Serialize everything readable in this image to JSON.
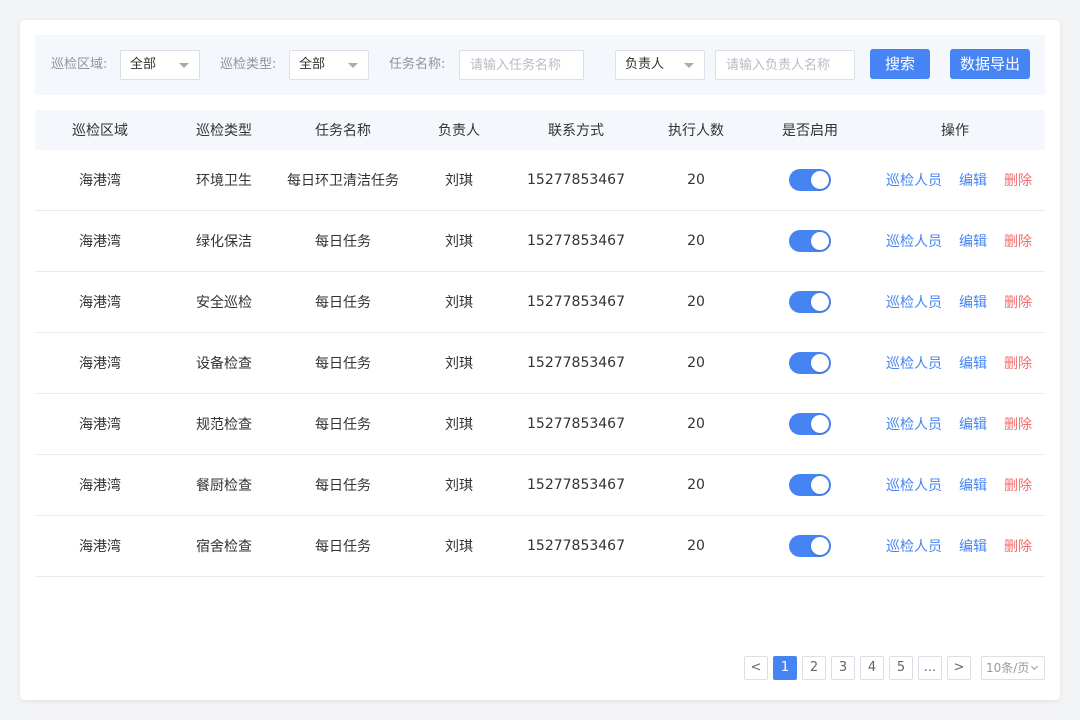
{
  "filters": {
    "area_label": "巡检区域:",
    "area_value": "全部",
    "type_label": "巡检类型:",
    "type_value": "全部",
    "task_label": "任务名称:",
    "task_placeholder": "请输入任务名称",
    "owner_select_value": "负责人",
    "owner_placeholder": "请输入负责人名称",
    "search_label": "搜索",
    "export_label": "数据导出"
  },
  "table": {
    "headers": [
      "巡检区域",
      "巡检类型",
      "任务名称",
      "负责人",
      "联系方式",
      "执行人数",
      "是否启用",
      "操作"
    ],
    "rows": [
      {
        "area": "海港湾",
        "type": "环境卫生",
        "task": "每日环卫清洁任务",
        "owner": "刘琪",
        "phone": "15277853467",
        "count": "20",
        "enabled": true
      },
      {
        "area": "海港湾",
        "type": "绿化保洁",
        "task": "每日任务",
        "owner": "刘琪",
        "phone": "15277853467",
        "count": "20",
        "enabled": true
      },
      {
        "area": "海港湾",
        "type": "安全巡检",
        "task": "每日任务",
        "owner": "刘琪",
        "phone": "15277853467",
        "count": "20",
        "enabled": true
      },
      {
        "area": "海港湾",
        "type": "设备检查",
        "task": "每日任务",
        "owner": "刘琪",
        "phone": "15277853467",
        "count": "20",
        "enabled": true
      },
      {
        "area": "海港湾",
        "type": "规范检查",
        "task": "每日任务",
        "owner": "刘琪",
        "phone": "15277853467",
        "count": "20",
        "enabled": true
      },
      {
        "area": "海港湾",
        "type": "餐厨检查",
        "task": "每日任务",
        "owner": "刘琪",
        "phone": "15277853467",
        "count": "20",
        "enabled": true
      },
      {
        "area": "海港湾",
        "type": "宿舍检查",
        "task": "每日任务",
        "owner": "刘琪",
        "phone": "15277853467",
        "count": "20",
        "enabled": true
      }
    ],
    "actions": {
      "inspectors": "巡检人员",
      "edit": "编辑",
      "delete": "删除"
    }
  },
  "pagination": {
    "prev": "<",
    "pages": [
      "1",
      "2",
      "3",
      "4",
      "5",
      "..."
    ],
    "current": "1",
    "next": ">",
    "page_size": "10条/页"
  },
  "colors": {
    "primary": "#4684f3",
    "danger": "#f56c6c",
    "header_bg": "#f4f7fb"
  }
}
